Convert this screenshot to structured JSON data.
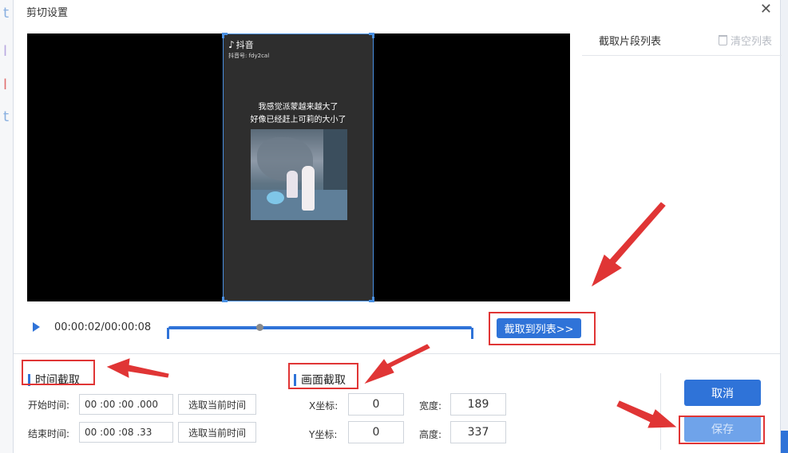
{
  "dialog": {
    "title": "剪切设置",
    "close_glyph": "✕"
  },
  "video": {
    "platform_label": "抖音",
    "platform_id": "抖音号: fdy2cal",
    "caption_line1": "我感觉派蒙越来越大了",
    "caption_line2": "好像已经赶上可莉的大小了"
  },
  "player": {
    "time_display": "00:00:02/00:00:08",
    "progress": 0.3,
    "add_to_list_label": "截取到列表>>"
  },
  "clip_list": {
    "title": "截取片段列表",
    "clear_label": "清空列表"
  },
  "time_section": {
    "title": "时间截取",
    "start_label": "开始时间:",
    "start_value": "00 :00 :00 .000",
    "end_label": "结束时间:",
    "end_value": "00 :00 :08 .33",
    "pick_current_label": "选取当前时间"
  },
  "frame_section": {
    "title": "画面截取",
    "x_label": "X坐标:",
    "x_value": "0",
    "y_label": "Y坐标:",
    "y_value": "0",
    "width_label": "宽度:",
    "width_value": "189",
    "height_label": "高度:",
    "height_value": "337"
  },
  "actions": {
    "cancel_label": "取消",
    "save_label": "保存"
  },
  "colors": {
    "accent": "#2f73d8",
    "annotation": "#e03535"
  }
}
